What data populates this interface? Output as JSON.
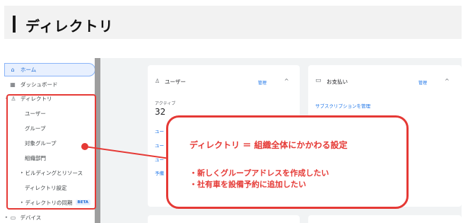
{
  "page_title": "ディレクトリ",
  "sidebar": {
    "items": [
      {
        "label": "ホーム",
        "icon": "home-icon"
      },
      {
        "label": "ダッシュボード",
        "icon": "dashboard-icon"
      },
      {
        "label": "ディレクトリ",
        "icon": "person-icon"
      },
      {
        "label": "ユーザー"
      },
      {
        "label": "グループ"
      },
      {
        "label": "対象グループ"
      },
      {
        "label": "組織部門"
      },
      {
        "label": "ビルディングとリソース"
      },
      {
        "label": "ディレクトリ設定"
      },
      {
        "label": "ディレクトリの同期",
        "badge": "BETA"
      },
      {
        "label": "デバイス",
        "icon": "devices-icon"
      }
    ]
  },
  "cards": {
    "users": {
      "title": "ユーザー",
      "manage": "管理",
      "active_label": "アクティブ",
      "active_count": "32",
      "links": [
        "ユー",
        "ユー",
        "ユー",
        "予備"
      ]
    },
    "billing": {
      "title": "お支払い",
      "manage": "管理",
      "link": "サブスクリプションを管理"
    }
  },
  "callout": {
    "title": "ディレクトリ ＝ 組織全体にかかわる設定",
    "lines": [
      "・新しくグループアドレスを作成したい",
      "・社有車を設備予約に追加したい"
    ]
  },
  "colors": {
    "annotation_red": "#e53935",
    "link_blue": "#1a73e8"
  }
}
